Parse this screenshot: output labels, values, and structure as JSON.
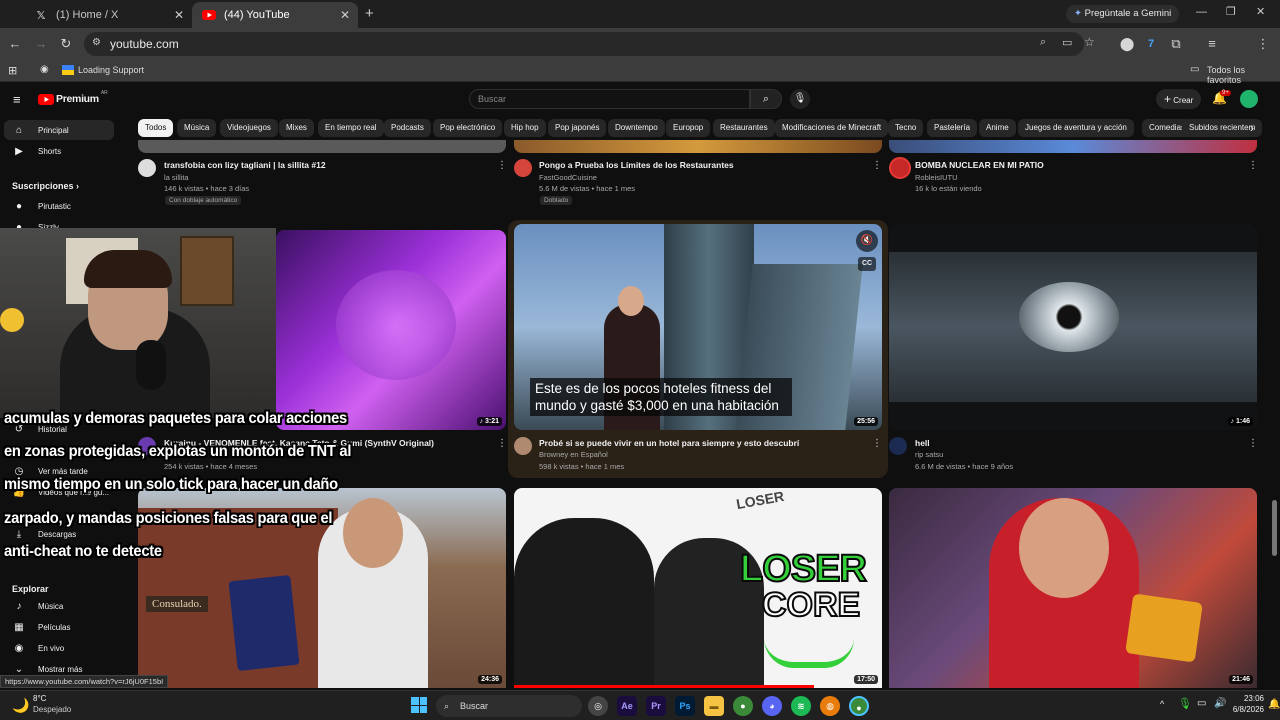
{
  "browser": {
    "tabs": [
      {
        "label": "(1) Home / X",
        "icon": "x-logo-icon"
      },
      {
        "label": "(44) YouTube",
        "icon": "youtube-icon"
      }
    ],
    "new_tab": "+",
    "gemini_button": "Pregúntale a Gemini",
    "url": "youtube.com",
    "bookmark": "Loading Support",
    "all_bookmarks": "Todos los favoritos"
  },
  "youtube": {
    "logo_text": "Premium",
    "logo_superscript": "AR",
    "search_placeholder": "Buscar",
    "create_label": "Crear",
    "notif_count": "9+",
    "chips": [
      "Todos",
      "Música",
      "Videojuegos",
      "Mixes",
      "En tiempo real",
      "Podcasts",
      "Pop electrónico",
      "Hip hop",
      "Pop japonés",
      "Downtempo",
      "Europop",
      "Restaurantes",
      "Modificaciones de Minecraft",
      "Tecno",
      "Pastelería",
      "Anime",
      "Juegos de aventura y acción",
      "Comedias",
      "Subidos recientem"
    ]
  },
  "sidebar": {
    "home": "Principal",
    "shorts": "Shorts",
    "subscriptions": "Suscripciones",
    "sub_items": [
      "Pirutastic",
      "Sizzly"
    ],
    "history": "Historial",
    "watch_later": "Ver más tarde",
    "your_videos": "Videos que me gu...",
    "downloads": "Descargas",
    "explore": "Explorar",
    "music": "Música",
    "movies": "Películas",
    "live": "En vivo",
    "more": "Mostrar más"
  },
  "videos_row1": [
    {
      "title": "transfobia con lizy tagliani | la sillita #12",
      "channel": "la sillita",
      "meta": "146 k vistas • hace 3 días",
      "badge": "Con doblaje automático"
    },
    {
      "title": "Pongo a Prueba los Límites de los Restaurantes",
      "channel": "FastGoodCuisine",
      "meta": "5.6 M de vistas • hace 1 mes",
      "badge": "Doblado"
    },
    {
      "title": "BOMBA NUCLEAR EN MI PATIO",
      "channel": "RobleisIUTU",
      "meta": "16 k lo están viendo"
    }
  ],
  "videos_row2": [
    {
      "title": "Kurainu - VENOMENLE feat. Kasane Teto & Gumi (SynthV Original)",
      "channel": "",
      "meta": "254 k vistas • hace 4 meses",
      "duration": "3:21"
    },
    {
      "title": "Probé si se puede vivir en un hotel para siempre y esto descubrí",
      "channel": "Browney en Español",
      "meta": "598 k vistas • hace 1 mes",
      "duration": "25:56",
      "caption": "Este es de los pocos hoteles fitness del mundo y gasté $3,000 en una habitación"
    },
    {
      "title": "hell",
      "channel": "rip satsu",
      "meta": "6.6 M de vistas • hace 9 años",
      "duration": "1:46"
    }
  ],
  "videos_row3": [
    {
      "duration": "24:36",
      "thumb_text": "Consulado."
    },
    {
      "duration": "17:50",
      "thumb_text_1": "LOSER",
      "thumb_text_2": "CORE",
      "thumb_text_3": "LOSER"
    },
    {
      "duration": "21:46"
    }
  ],
  "overlay_lines": [
    "acumulas y demoras paquetes para colar acciones",
    "en zonas protegidas, explotas un montón de TNT al",
    "mismo tiempo en un solo tick para hacer un daño",
    "zarpado, y mandas posiciones falsas para que el",
    "anti-cheat no te detecte"
  ],
  "status_url": "https://www.youtube.com/watch?v=rJ6jU0F15bI",
  "taskbar": {
    "weather_temp": "8°C",
    "weather_desc": "Despejado",
    "search": "Buscar",
    "time": "23:06",
    "date": "6/8/2026"
  },
  "colors": {
    "yt_red": "#ff0000",
    "bg": "#0f0f0f",
    "chip": "#272727"
  }
}
